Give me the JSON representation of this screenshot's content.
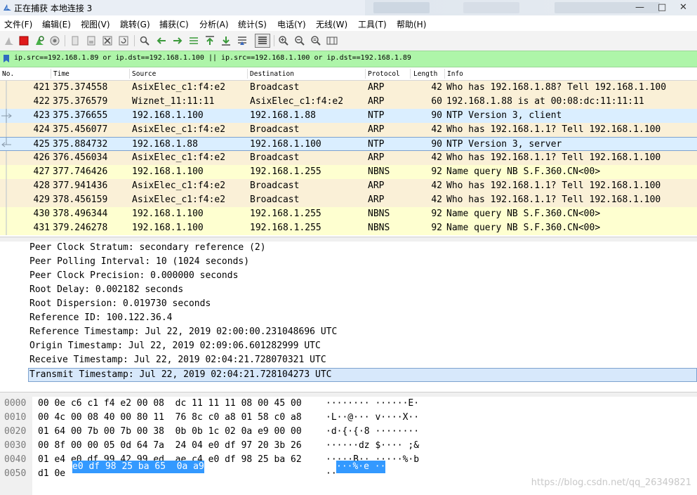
{
  "window": {
    "title": "正在捕获 本地连接 3",
    "controls": {
      "minimize": "—",
      "restore": "□",
      "close": "✕"
    }
  },
  "menubar": {
    "items": [
      "文件(F)",
      "编辑(E)",
      "视图(V)",
      "跳转(G)",
      "捕获(C)",
      "分析(A)",
      "统计(S)",
      "电话(Y)",
      "无线(W)",
      "工具(T)",
      "帮助(H)"
    ]
  },
  "toolbar": {
    "icons": [
      "shark-fin-start-icon",
      "stop-icon",
      "restart-icon",
      "capture-options-icon",
      "open-file-icon",
      "save-file-icon",
      "close-file-icon",
      "reload-icon",
      "find-icon",
      "back-arrow-icon",
      "forward-arrow-icon",
      "goto-packet-icon",
      "first-packet-icon",
      "last-packet-icon",
      "autoscroll-icon",
      "colorize-icon",
      "zoom-in-icon",
      "zoom-out-icon",
      "zoom-normal-icon",
      "resize-columns-icon"
    ]
  },
  "filter": {
    "text": "ip.src==192.168.1.89 or ip.dst==192.168.1.100 || ip.src==192.168.1.100 or ip.dst==192.168.1.89",
    "bg_color": "#aef5a9"
  },
  "packet_list": {
    "columns": [
      "No.",
      "Time",
      "Source",
      "Destination",
      "Protocol",
      "Length",
      "Info"
    ],
    "rows": [
      {
        "no": "421",
        "time": "375.374558",
        "src": "AsixElec_c1:f4:e2",
        "dst": "Broadcast",
        "proto": "ARP",
        "len": "42",
        "info": "Who has 192.168.1.88? Tell 192.168.1.100",
        "bg": "#faf0d7",
        "marker": ""
      },
      {
        "no": "422",
        "time": "375.376579",
        "src": "Wiznet_11:11:11",
        "dst": "AsixElec_c1:f4:e2",
        "proto": "ARP",
        "len": "60",
        "info": "192.168.1.88 is at 00:08:dc:11:11:11",
        "bg": "#faf0d7",
        "marker": ""
      },
      {
        "no": "423",
        "time": "375.376655",
        "src": "192.168.1.100",
        "dst": "192.168.1.88",
        "proto": "NTP",
        "len": "90",
        "info": "NTP Version 3, client",
        "bg": "#daeeff",
        "marker": "request"
      },
      {
        "no": "424",
        "time": "375.456077",
        "src": "AsixElec_c1:f4:e2",
        "dst": "Broadcast",
        "proto": "ARP",
        "len": "42",
        "info": "Who has 192.168.1.1? Tell 192.168.1.100",
        "bg": "#faf0d7",
        "marker": ""
      },
      {
        "no": "425",
        "time": "375.884732",
        "src": "192.168.1.88",
        "dst": "192.168.1.100",
        "proto": "NTP",
        "len": "90",
        "info": "NTP Version 3, server",
        "bg": "#daeeff",
        "marker": "response",
        "selected": true
      },
      {
        "no": "426",
        "time": "376.456034",
        "src": "AsixElec_c1:f4:e2",
        "dst": "Broadcast",
        "proto": "ARP",
        "len": "42",
        "info": "Who has 192.168.1.1? Tell 192.168.1.100",
        "bg": "#faf0d7",
        "marker": ""
      },
      {
        "no": "427",
        "time": "377.746426",
        "src": "192.168.1.100",
        "dst": "192.168.1.255",
        "proto": "NBNS",
        "len": "92",
        "info": "Name query NB S.F.360.CN<00>",
        "bg": "#feffd0",
        "marker": ""
      },
      {
        "no": "428",
        "time": "377.941436",
        "src": "AsixElec_c1:f4:e2",
        "dst": "Broadcast",
        "proto": "ARP",
        "len": "42",
        "info": "Who has 192.168.1.1? Tell 192.168.1.100",
        "bg": "#faf0d7",
        "marker": ""
      },
      {
        "no": "429",
        "time": "378.456159",
        "src": "AsixElec_c1:f4:e2",
        "dst": "Broadcast",
        "proto": "ARP",
        "len": "42",
        "info": "Who has 192.168.1.1? Tell 192.168.1.100",
        "bg": "#faf0d7",
        "marker": ""
      },
      {
        "no": "430",
        "time": "378.496344",
        "src": "192.168.1.100",
        "dst": "192.168.1.255",
        "proto": "NBNS",
        "len": "92",
        "info": "Name query NB S.F.360.CN<00>",
        "bg": "#feffd0",
        "marker": ""
      },
      {
        "no": "431",
        "time": "379.246278",
        "src": "192.168.1.100",
        "dst": "192.168.1.255",
        "proto": "NBNS",
        "len": "92",
        "info": "Name query NB S.F.360.CN<00>",
        "bg": "#feffd0",
        "marker": ""
      }
    ]
  },
  "detail": {
    "lines": [
      "Peer Clock Stratum: secondary reference (2)",
      "Peer Polling Interval: 10 (1024 seconds)",
      "Peer Clock Precision: 0.000000 seconds",
      "Root Delay: 0.002182 seconds",
      "Root Dispersion: 0.019730 seconds",
      "Reference ID: 100.122.36.4",
      "Reference Timestamp: Jul 22, 2019 02:00:00.231048696 UTC",
      "Origin Timestamp: Jul 22, 2019 02:09:06.601282999 UTC",
      "Receive Timestamp: Jul 22, 2019 02:04:21.728070321 UTC",
      "Transmit Timestamp: Jul 22, 2019 02:04:21.728104273 UTC"
    ],
    "selected_index": 9
  },
  "bytes": {
    "lines": [
      {
        "off": "0000",
        "hex": "00 0e c6 c1 f4 e2 00 08  dc 11 11 11 08 00 45 00",
        "ascii": "········ ······E·"
      },
      {
        "off": "0010",
        "hex": "00 4c 00 08 40 00 80 11  76 8c c0 a8 01 58 c0 a8",
        "ascii": "·L··@··· v····X··"
      },
      {
        "off": "0020",
        "hex": "01 64 00 7b 00 7b 00 38  0b 0b 1c 02 0a e9 00 00",
        "ascii": "·d·{·{·8 ········"
      },
      {
        "off": "0030",
        "hex": "00 8f 00 00 05 0d 64 7a  24 04 e0 df 97 20 3b 26",
        "ascii": "······dz $···· ;&"
      },
      {
        "off": "0040",
        "hex": "01 e4 e0 df 99 42 99 ed  ae c4 e0 df 98 25 ba 62",
        "ascii": "·····B·· ·····%·b"
      },
      {
        "off": "0050",
        "hex": "d1 0e",
        "ascii": "··"
      }
    ],
    "highlight_hex": "e0 df 98 25 ba 65  0a a9",
    "highlight_ascii": "···%·e ··",
    "highlight_color": "#3399ff"
  },
  "watermark": "https://blog.csdn.net/qq_26349821"
}
